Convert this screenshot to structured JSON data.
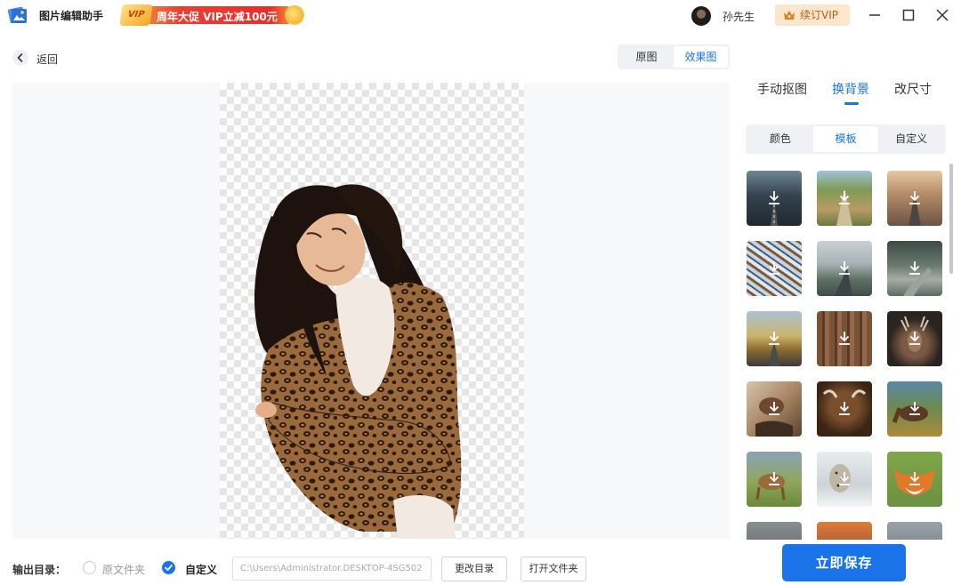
{
  "app": {
    "title": "图片编辑助手"
  },
  "promo": {
    "vip_badge": "VIP",
    "text": "周年大促 VIP立减100元"
  },
  "user": {
    "name": "孙先生",
    "renew_label": "续订VIP"
  },
  "nav": {
    "back_label": "返回"
  },
  "view_toggle": {
    "original_label": "原图",
    "result_label": "效果图",
    "selected": "效果图"
  },
  "panel": {
    "tabs": [
      {
        "label": "手动抠图"
      },
      {
        "label": "换背景"
      },
      {
        "label": "改尺寸"
      }
    ],
    "active_tab": "换背景",
    "subtabs": [
      {
        "label": "颜色"
      },
      {
        "label": "模板"
      },
      {
        "label": "自定义"
      }
    ],
    "active_subtab": "模板",
    "templates": [
      {
        "name": "road-dusk-icon"
      },
      {
        "name": "rural-road-icon"
      },
      {
        "name": "desert-road-icon"
      },
      {
        "name": "snowy-branches-icon"
      },
      {
        "name": "misty-road-icon"
      },
      {
        "name": "forest-road-icon"
      },
      {
        "name": "autumn-road-icon"
      },
      {
        "name": "bark-texture-icon"
      },
      {
        "name": "deer-icon"
      },
      {
        "name": "bird-icon"
      },
      {
        "name": "yak-icon"
      },
      {
        "name": "horse-icon"
      },
      {
        "name": "fawn-icon"
      },
      {
        "name": "leopard-snow-icon"
      },
      {
        "name": "fox-icon"
      },
      {
        "name": "car-icon"
      },
      {
        "name": "sunset-icon"
      },
      {
        "name": "mountain-icon"
      }
    ]
  },
  "output": {
    "label": "输出目录：",
    "option_original": "原文件夹",
    "option_custom": "自定义",
    "selected": "自定义",
    "path": "C:\\Users\\Administrator.DESKTOP-4SG502",
    "change_dir_label": "更改目录",
    "open_folder_label": "打开文件夹",
    "save_label": "立即保存"
  },
  "colors": {
    "accent": "#1a73e8",
    "vip_bg": "#fde6cc",
    "vip_text": "#b4621a",
    "promo_red": "#e92e2a"
  }
}
